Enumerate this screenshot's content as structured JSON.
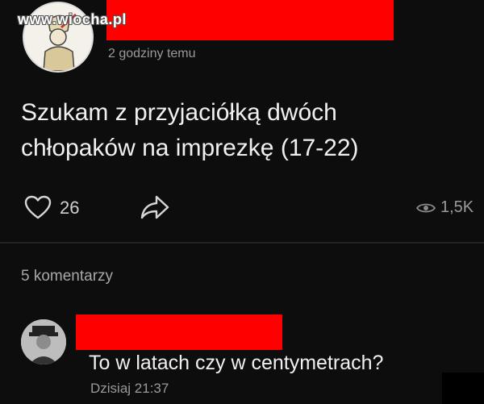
{
  "watermark": "www.wiocha.pl",
  "post": {
    "timestamp": "2 godziny temu",
    "text_line1": "Szukam z przyjaciółką dwóch",
    "text_line2": "chłopaków na imprezkę (17-22)",
    "likes": "26",
    "views": "1,5K"
  },
  "comments": {
    "count_label": "5 komentarzy",
    "items": [
      {
        "text": "To w latach czy w centymetrach?",
        "time": "Dzisiaj 21:37"
      }
    ]
  },
  "colors": {
    "background": "#0d0d0d",
    "redaction": "#ff0000",
    "text": "#f0f0f0",
    "muted": "#9a9a9a"
  },
  "icons": [
    "heart-icon",
    "share-arrow-icon",
    "eye-icon"
  ]
}
